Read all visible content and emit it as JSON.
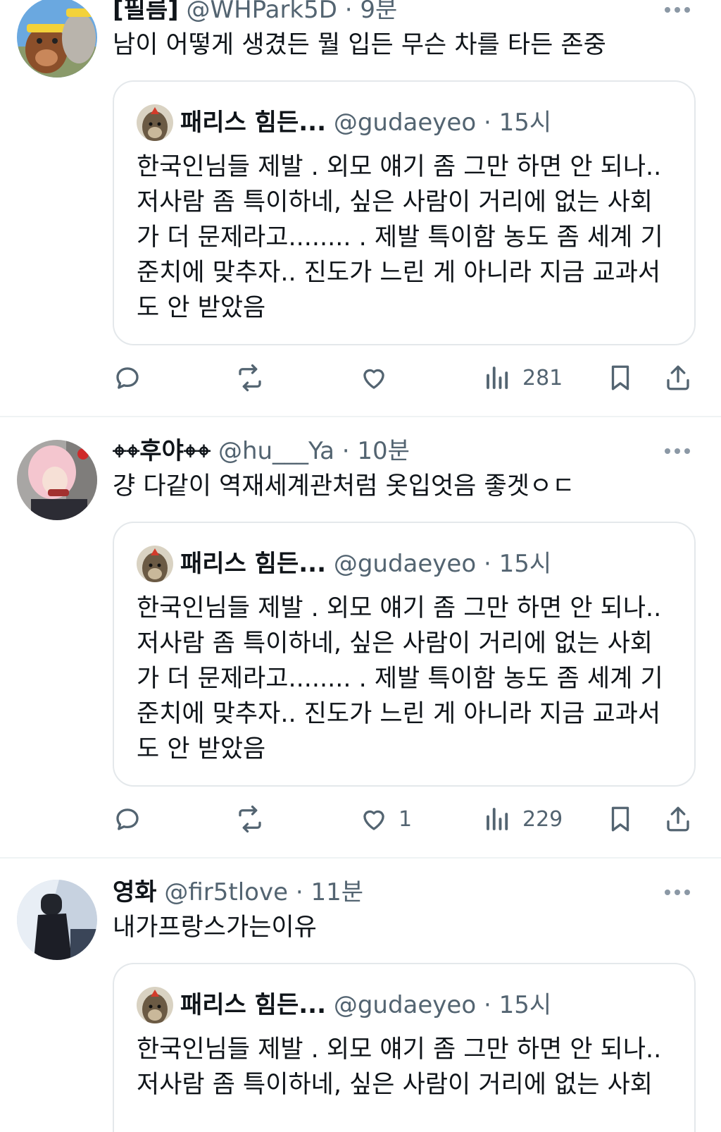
{
  "tweets": [
    {
      "name": "[필름]",
      "handle": "@WHPark5D",
      "sep": "·",
      "time": "9분",
      "text": "남이 어떻게 생겼든 뭘 입든 무슨 차를 타든 존중",
      "quote": {
        "name": "패리스 힘든...",
        "handle": "@gudaeyeo",
        "sep": "·",
        "time": "15시",
        "lines": [
          "한국인님들 제발 . 외모 얘기 좀 그만 하면 안 되나..",
          "저사람 좀 특이하네, 싶은 사람이 거리에 없는 사회",
          "가 더 문제라고........ . 제발 특이함 농도 좀 세계 기",
          "준치에 맞추자.. 진도가 느린 게 아니라 지금 교과서",
          "도 안 받았음"
        ]
      },
      "actions": {
        "replies": "",
        "reposts": "",
        "likes": "",
        "views": "281"
      }
    },
    {
      "name": "⌖⌖후야⌖⌖",
      "handle": "@hu___Ya",
      "sep": "·",
      "time": "10분",
      "text": "걍 다같이 역재세계관처럼 옷입엇음 좋겟ㅇㄷ",
      "quote": {
        "name": "패리스 힘든...",
        "handle": "@gudaeyeo",
        "sep": "·",
        "time": "15시",
        "lines": [
          "한국인님들 제발 . 외모 얘기 좀 그만 하면 안 되나..",
          "저사람 좀 특이하네, 싶은 사람이 거리에 없는 사회",
          "가 더 문제라고........ . 제발 특이함 농도 좀 세계 기",
          "준치에 맞추자.. 진도가 느린 게 아니라 지금 교과서",
          "도 안 받았음"
        ]
      },
      "actions": {
        "replies": "",
        "reposts": "",
        "likes": "1",
        "views": "229"
      }
    },
    {
      "name": "영화",
      "handle": "@fir5tlove",
      "sep": "·",
      "time": "11분",
      "text": "내가프랑스가는이유",
      "quote": {
        "name": "패리스 힘든...",
        "handle": "@gudaeyeo",
        "sep": "·",
        "time": "15시",
        "lines": [
          "한국인님들 제발 . 외모 얘기 좀 그만 하면 안 되나..",
          "저사람 좀 특이하네, 싶은 사람이 거리에 없는 사회"
        ]
      }
    }
  ],
  "icons": {
    "more": "more-dots-icon",
    "reply": "reply-icon",
    "repost": "repost-icon",
    "like": "heart-icon",
    "views": "views-icon",
    "bookmark": "bookmark-icon",
    "share": "share-icon"
  },
  "colors": {
    "text": "#0f1419",
    "muted": "#536471",
    "border": "#e4e8eb",
    "divider": "#eff3f4"
  }
}
